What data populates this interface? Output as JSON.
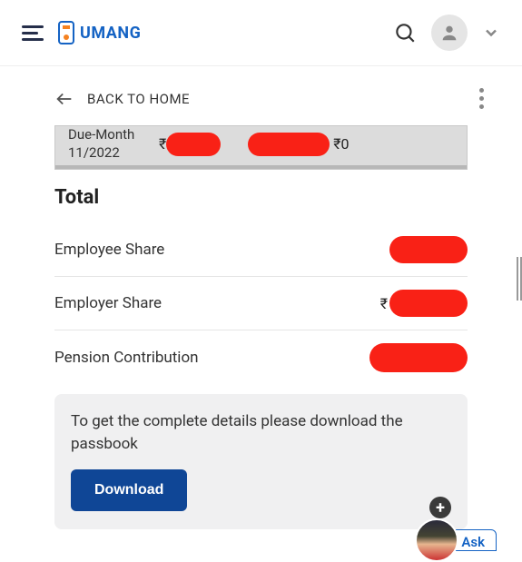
{
  "header": {
    "brand": "UMANG"
  },
  "nav": {
    "back_label": "BACK TO HOME"
  },
  "summary_row": {
    "label_part1": "Due-Month 11/2022",
    "rupee": "₹",
    "zero": "₹0"
  },
  "totals": {
    "title": "Total",
    "rows": [
      {
        "label": "Employee Share"
      },
      {
        "label": "Employer Share",
        "prefix": "₹"
      },
      {
        "label": "Pension Contribution"
      }
    ]
  },
  "note": {
    "text": "To get the complete details please download the passbook",
    "button": "Download"
  },
  "ask": {
    "label": "Ask"
  }
}
